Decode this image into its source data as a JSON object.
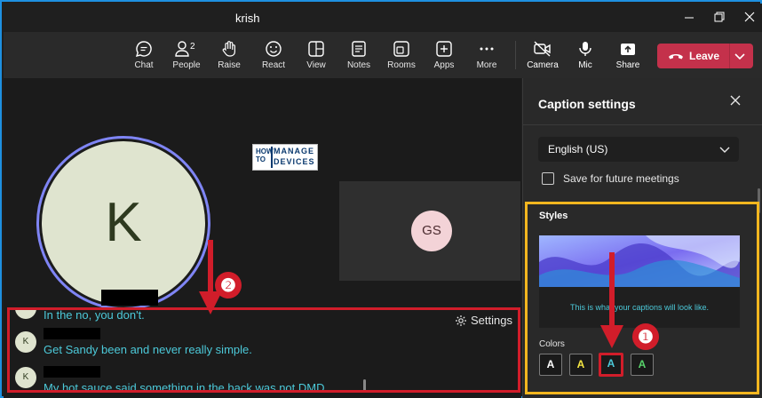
{
  "window": {
    "title": "krish"
  },
  "toolbar": {
    "items": [
      {
        "label": "Chat",
        "icon": "chat-icon"
      },
      {
        "label": "People",
        "icon": "people-icon",
        "badge": "2"
      },
      {
        "label": "Raise",
        "icon": "raise-hand-icon"
      },
      {
        "label": "React",
        "icon": "react-icon"
      },
      {
        "label": "View",
        "icon": "view-icon"
      },
      {
        "label": "Notes",
        "icon": "notes-icon"
      },
      {
        "label": "Rooms",
        "icon": "rooms-icon"
      },
      {
        "label": "Apps",
        "icon": "apps-icon"
      },
      {
        "label": "More",
        "icon": "more-icon"
      },
      {
        "label": "Camera",
        "icon": "camera-off-icon"
      },
      {
        "label": "Mic",
        "icon": "mic-icon"
      },
      {
        "label": "Share",
        "icon": "share-icon"
      }
    ],
    "leave_label": "Leave",
    "leave_color": "#c4314b"
  },
  "stage": {
    "main_avatar_initial": "K",
    "logo": {
      "how_to": "HOW TO",
      "manage": "MANAGE",
      "devices": "DEVICES"
    },
    "gs_initials": "GS"
  },
  "captions": {
    "settings_label": "Settings",
    "lines": [
      {
        "avatar": "K",
        "text": "In the no, you don't."
      },
      {
        "avatar": "K",
        "text": "Get Sandy been and never really simple."
      },
      {
        "avatar": "K",
        "text": "My hot sauce said something in the back was not DMD."
      }
    ],
    "text_color": "#4cc9d9"
  },
  "annotations": {
    "badge_1": "❶",
    "badge_2": "❷"
  },
  "panel": {
    "title": "Caption settings",
    "language": "English (US)",
    "save_label": "Save for future meetings",
    "styles_title": "Styles",
    "preview_text": "This is what your captions will look like.",
    "colors_title": "Colors",
    "swatches": [
      {
        "label": "A",
        "color": "#ffffff"
      },
      {
        "label": "A",
        "color": "#f5e642"
      },
      {
        "label": "A",
        "color": "#4cc9d9",
        "selected": true
      },
      {
        "label": "A",
        "color": "#58d36b"
      }
    ]
  }
}
